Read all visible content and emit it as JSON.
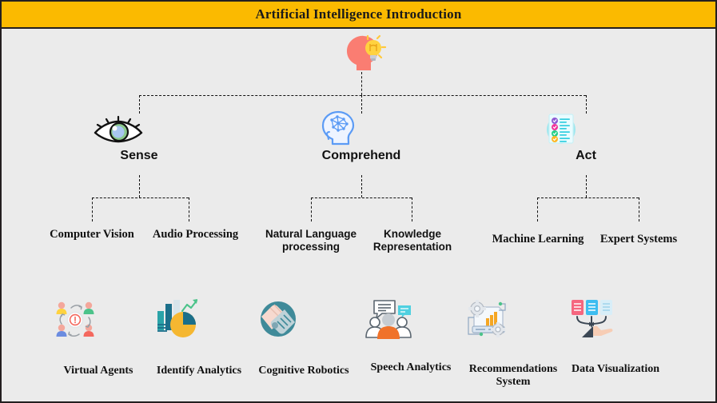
{
  "title": {
    "text": "Artificial Intelligence Introduction",
    "background_color": "#fbba00",
    "text_color": "#1a1a1a"
  },
  "canvas": {
    "background_color": "#ebebeb",
    "border_color": "#231f20",
    "connector_color": "#111111",
    "connector_style": "dashed"
  },
  "root": {
    "icon": "head-lightbulb-icon",
    "label": ""
  },
  "branches": [
    {
      "id": "sense",
      "label": "Sense",
      "icon": "eye-icon",
      "children": [
        {
          "label": "Computer Vision"
        },
        {
          "label": "Audio Processing"
        }
      ]
    },
    {
      "id": "comprehend",
      "label": "Comprehend",
      "icon": "brain-head-icon",
      "children": [
        {
          "label_line1": "Natural Language",
          "label_line2": "processing"
        },
        {
          "label_line1": "Knowledge",
          "label_line2": "Representation"
        }
      ]
    },
    {
      "id": "act",
      "label": "Act",
      "icon": "checklist-icon",
      "children": [
        {
          "label": "Machine Learning"
        },
        {
          "label": "Expert Systems"
        }
      ]
    }
  ],
  "applications": [
    {
      "id": "virtual-agents",
      "label": "Virtual Agents",
      "icon": "users-network-icon"
    },
    {
      "id": "identify-analytics",
      "label": "Identify Analytics",
      "icon": "charts-pie-icon"
    },
    {
      "id": "cognitive-robotics",
      "label": "Cognitive Robotics",
      "icon": "handshake-robot-icon"
    },
    {
      "id": "speech-analytics",
      "label": "Speech Analytics",
      "icon": "people-speech-icon"
    },
    {
      "id": "recommendations-system",
      "label_line1": "Recommendations",
      "label_line2": "System",
      "icon": "gears-chart-icon"
    },
    {
      "id": "data-visualization",
      "label": "Data Visualization",
      "icon": "hand-data-cards-icon"
    }
  ],
  "palette": {
    "amber": "#fbba00",
    "salmon": "#fa7d72",
    "bulb_yellow": "#ffd23f",
    "eye_green": "#8bc98b",
    "eye_blue": "#a8c5f0",
    "brain_blue": "#5b9bf5",
    "act_cyan": "#9fe8ef",
    "teal": "#3f8a99",
    "orange": "#f0722a"
  }
}
